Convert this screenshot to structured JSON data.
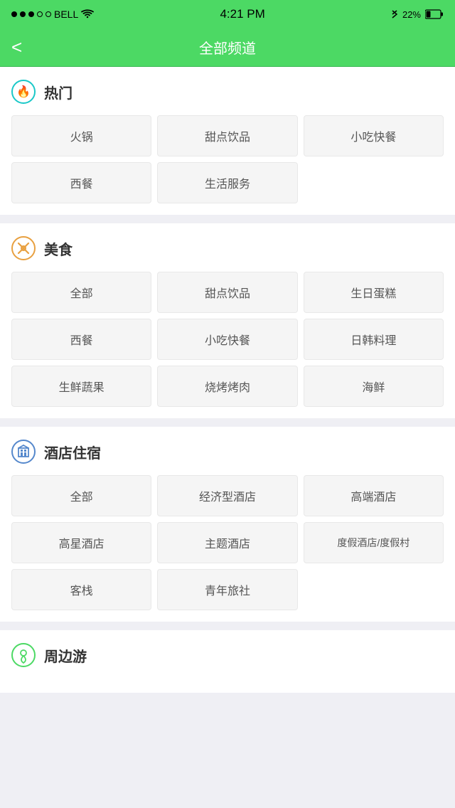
{
  "statusBar": {
    "carrier": "BELL",
    "time": "4:21 PM",
    "battery": "22%"
  },
  "navBar": {
    "title": "全部频道",
    "backLabel": "<"
  },
  "sections": [
    {
      "id": "hot",
      "iconType": "flame",
      "iconColor": "#1ac8c8",
      "title": "热门",
      "items": [
        [
          "火锅",
          "甜点饮品",
          "小吃快餐"
        ],
        [
          "西餐",
          "生活服务"
        ]
      ]
    },
    {
      "id": "food",
      "iconType": "fork",
      "iconColor": "#e8a040",
      "title": "美食",
      "items": [
        [
          "全部",
          "甜点饮品",
          "生日蛋糕"
        ],
        [
          "西餐",
          "小吃快餐",
          "日韩料理"
        ],
        [
          "生鲜蔬果",
          "烧烤烤肉",
          "海鲜"
        ]
      ]
    },
    {
      "id": "hotel",
      "iconType": "building",
      "iconColor": "#5588cc",
      "title": "酒店住宿",
      "items": [
        [
          "全部",
          "经济型酒店",
          "高端酒店"
        ],
        [
          "高星酒店",
          "主题酒店",
          "度假酒店/度假村"
        ],
        [
          "客栈",
          "青年旅社"
        ]
      ]
    },
    {
      "id": "nearby",
      "iconType": "map",
      "iconColor": "#4cd964",
      "title": "周边游",
      "items": []
    }
  ]
}
